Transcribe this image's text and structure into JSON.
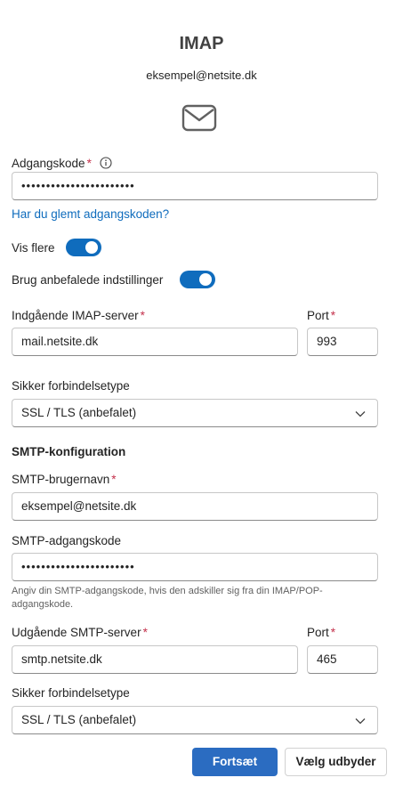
{
  "header": {
    "title": "IMAP",
    "email": "eksempel@netsite.dk"
  },
  "password": {
    "label": "Adgangskode",
    "required_mark": "*",
    "value": "•••••••••••••••••••••••",
    "forgot_link": "Har du glemt adgangskoden?"
  },
  "toggles": {
    "show_more_label": "Vis flere",
    "show_more_on": true,
    "recommended_label": "Brug anbefalede indstillinger",
    "recommended_on": true
  },
  "incoming": {
    "server_label": "Indgående IMAP-server",
    "server_value": "mail.netsite.dk",
    "port_label": "Port",
    "port_value": "993",
    "security_label": "Sikker forbindelsetype",
    "security_value": "SSL / TLS (anbefalet)"
  },
  "smtp": {
    "section_title": "SMTP-konfiguration",
    "username_label": "SMTP-brugernavn",
    "username_value": "eksempel@netsite.dk",
    "password_label": "SMTP-adgangskode",
    "password_value": "•••••••••••••••••••••••",
    "password_hint": "Angiv din SMTP-adgangskode, hvis den adskiller sig fra din IMAP/POP-adgangskode.",
    "server_label": "Udgående SMTP-server",
    "server_value": "smtp.netsite.dk",
    "port_label": "Port",
    "port_value": "465",
    "security_label": "Sikker forbindelsetype",
    "security_value": "SSL / TLS (anbefalet)"
  },
  "actions": {
    "continue_label": "Fortsæt",
    "choose_provider_label": "Vælg udbyder"
  },
  "icons": {
    "mail": "mail-icon",
    "info": "info-icon",
    "chevron": "chevron-down-icon"
  },
  "colors": {
    "accent": "#0f6cbd",
    "primary_button": "#2b6cc1",
    "required": "#c4314b"
  }
}
